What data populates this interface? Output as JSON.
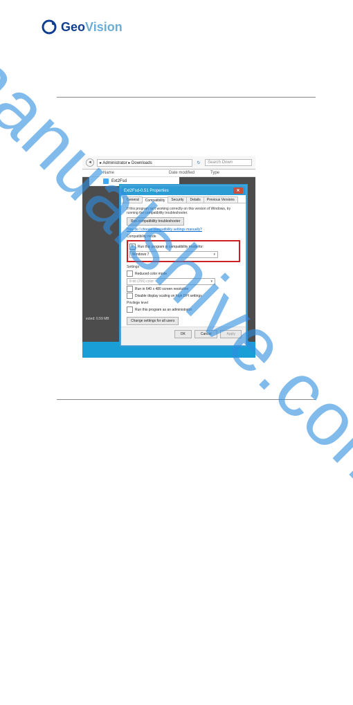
{
  "logo": {
    "geo": "Geo",
    "vision": "Vision"
  },
  "watermark": "manualshive.com",
  "explorer": {
    "path": "▸ Administrator ▸ Downloads",
    "search_placeholder": "Search Down",
    "cols": {
      "name": "Name",
      "date": "Date modified",
      "type": "Type"
    },
    "file_label": "Ext2Fsd",
    "status_line": "ected: 0.59 MB"
  },
  "dialog": {
    "title": "Ext2Fsd-0.51 Properties",
    "tabs": {
      "general": "General",
      "compatibility": "Compatibility",
      "security": "Security",
      "details": "Details",
      "previous": "Previous Versions"
    },
    "help1": "If this program isn't working correctly on this version of Windows, try running the compatibility troubleshooter.",
    "troubleshoot": "Run compatibility troubleshooter",
    "link": "How do I choose compatibility settings manually?",
    "groups": {
      "compat_mode": "Compatibility mode",
      "compat_check": "Run this program in compatibility mode for:",
      "compat_value": "Windows 7",
      "settings": "Settings",
      "reduced_color": "Reduced color mode",
      "color_value": "8-bit (256) color",
      "res_640": "Run in 640 x 480 screen resolution",
      "dpi_scaling": "Disable display scaling on high DPI settings",
      "privilege": "Privilege level",
      "run_admin": "Run this program as an administrator",
      "change_all": "Change settings for all users"
    },
    "buttons": {
      "ok": "OK",
      "cancel": "Cancel",
      "apply": "Apply"
    }
  }
}
